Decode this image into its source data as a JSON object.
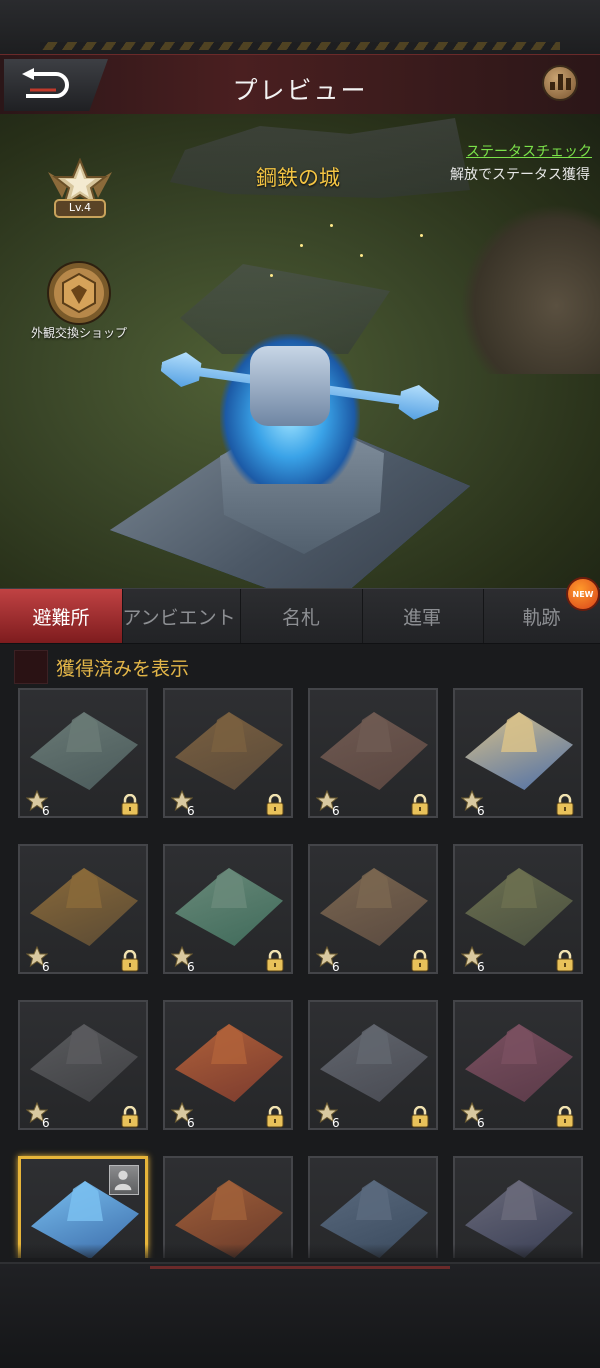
{
  "header": {
    "title": "プレビュー",
    "back_icon": "back-arrow-icon",
    "stats_icon": "bar-chart-icon"
  },
  "preview": {
    "building_name": "鋼鉄の城",
    "status_link": "ステータスチェック",
    "status_description": "解放でステータス獲得",
    "level_label": "Lv.4",
    "shop_label": "外観交換ショップ"
  },
  "tabs": [
    {
      "label": "避難所",
      "active": true
    },
    {
      "label": "アンビエント",
      "active": false
    },
    {
      "label": "名札",
      "active": false
    },
    {
      "label": "進軍",
      "active": false
    },
    {
      "label": "軌跡",
      "active": false,
      "badge": "NEW"
    }
  ],
  "filter": {
    "label": "獲得済みを表示",
    "checked": false
  },
  "skins": [
    {
      "stars": "6",
      "locked": true,
      "base": "#4a5a5a",
      "roof": "#6a7a76"
    },
    {
      "stars": "6",
      "locked": true,
      "base": "#5a4a3a",
      "roof": "#7a6040"
    },
    {
      "stars": "6",
      "locked": true,
      "base": "#5a4640",
      "roof": "#6f5a52"
    },
    {
      "stars": "6",
      "locked": true,
      "base": "#4c6ea8",
      "roof": "#d9c28a"
    },
    {
      "stars": "6",
      "locked": true,
      "base": "#5a4a34",
      "roof": "#8a6a3a"
    },
    {
      "stars": "6",
      "locked": true,
      "base": "#3f6a5a",
      "roof": "#6a8a7a"
    },
    {
      "stars": "6",
      "locked": true,
      "base": "#5a4a40",
      "roof": "#7a6650"
    },
    {
      "stars": "6",
      "locked": true,
      "base": "#4a5040",
      "roof": "#6c7050"
    },
    {
      "stars": "6",
      "locked": true,
      "base": "#3f4043",
      "roof": "#5a5b5e"
    },
    {
      "stars": "6",
      "locked": true,
      "base": "#7a3a2e",
      "roof": "#b0623a"
    },
    {
      "stars": "6",
      "locked": true,
      "base": "#484a52",
      "roof": "#62666e"
    },
    {
      "stars": "6",
      "locked": true,
      "base": "#5a3a48",
      "roof": "#7a5060"
    },
    {
      "stars": "",
      "locked": false,
      "selected": true,
      "base": "#3a6aa8",
      "roof": "#7ac0f0"
    },
    {
      "stars": "",
      "locked": false,
      "base": "#6a3a2a",
      "roof": "#a0603a"
    },
    {
      "stars": "",
      "locked": false,
      "base": "#3a4a5e",
      "roof": "#5a6a7e"
    },
    {
      "stars": "",
      "locked": false,
      "base": "#3a3f55",
      "roof": "#6a6a7a"
    }
  ],
  "colors": {
    "accent_red": "#c04243",
    "gold": "#e7b53a",
    "link_green": "#7be24a"
  }
}
